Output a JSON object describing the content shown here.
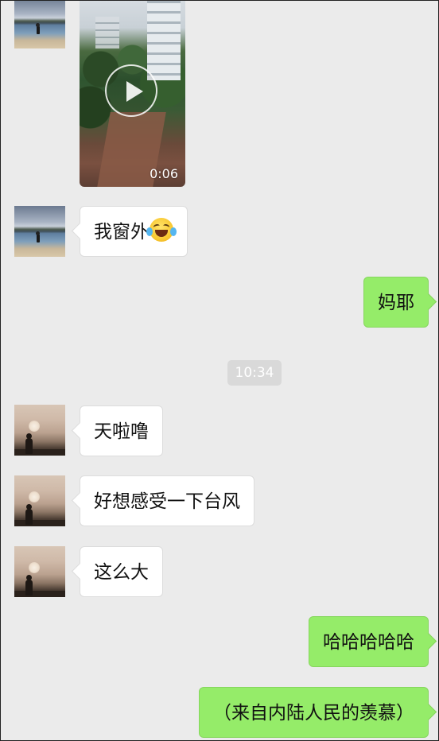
{
  "messages": {
    "video_duration": "0:06",
    "m1_text": "我窗外",
    "m2_text": "妈耶",
    "timestamp": "10:34",
    "m3_text": "天啦噜",
    "m4_text": "好想感受一下台风",
    "m5_text": "这么大",
    "m6_text": "哈哈哈哈哈",
    "m7_text": "（来自内陆人民的羡慕）"
  },
  "icons": {
    "play": "play-icon",
    "emoji": "tears-of-joy-emoji"
  },
  "colors": {
    "background": "#ebebeb",
    "incoming_bubble": "#ffffff",
    "outgoing_bubble": "#95ec69",
    "timestamp_bg": "#d9d9d9"
  }
}
